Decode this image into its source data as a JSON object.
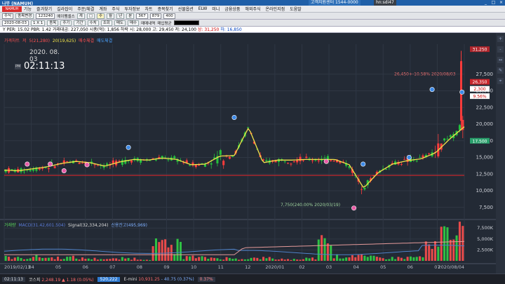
{
  "window": {
    "title": "나무 (NAMUH)",
    "customer_center": "고객지원센터 1544-0000",
    "account": "hn:sdi47",
    "buttons": [
      "_",
      "□",
      "×"
    ]
  },
  "menu": {
    "logo": "NAMUH",
    "items": [
      "기능",
      "즐겨찾기",
      "길라잡이",
      "주문/체결",
      "계좌",
      "주식",
      "투자정보",
      "차트",
      "종목찾기",
      "선물옵션",
      "ELW",
      "미니",
      "금융상품",
      "해외주식",
      "온라인지점",
      "도움말"
    ]
  },
  "toolbar1": {
    "chart_type": "주식",
    "search_label": "종목변경",
    "code": "123240",
    "name": "에이팸셀스",
    "tabs": [
      "계",
      "□",
      "주",
      "월",
      "년",
      "분"
    ],
    "period_value": "367",
    "count_value": "879",
    "view_value": "400"
  },
  "toolbar2": {
    "date": "2020-08-03",
    "x_label": "1 X 1",
    "buttons": [
      "종목",
      "주기",
      "기간",
      "수치",
      "조회"
    ],
    "right_buttons": [
      "매도",
      "매수"
    ],
    "trade_label": "매매내역",
    "avg_label": "매입평균",
    "color_box": ""
  },
  "info": {
    "text_left": "Y  PER: 15.02  PBR: 1.42  거래대금: 227,050  시총(억): 1,856  하락 시: 28,000  고: 29,450  저: 24,100",
    "high_label": "상: 31,250",
    "low_label": "하: 16,850"
  },
  "legend": {
    "items": [
      {
        "text": "가격차트",
        "color": "#ff5050"
      },
      {
        "text": "저",
        "color": "#ff5050"
      },
      {
        "text": "5(21,280)",
        "color": "#ff5050"
      },
      {
        "text": "20(19,625)",
        "color": "#f1e24a"
      },
      {
        "text": "매수체결",
        "color": "#ff5050"
      },
      {
        "text": "매도체결",
        "color": "#4aa3ff"
      }
    ]
  },
  "clock": {
    "date": "2020. 08. 03",
    "ampm": "PM",
    "time": "02:11:13"
  },
  "volume_legend": {
    "items": [
      {
        "text": "거래량",
        "color": "#5bd85b"
      },
      {
        "text": "MACD(31.42,601.504)",
        "color": "#5b7bd8"
      },
      {
        "text": "Signal(32,334,204)",
        "color": "#ddd"
      },
      {
        "text": "신용잔고(495,969)",
        "color": "#7fb0ff"
      }
    ]
  },
  "annotations": {
    "high": "26,450+-10.58% 2020/08/03",
    "low": "7,750(240.00% 2020/03/19)",
    "price_top": "31,250",
    "price_current": "26,350",
    "price_change": "2,300",
    "price_pct": "9.56%",
    "price_low_box": "17,500"
  },
  "colors": {
    "up": "#ff3b3b",
    "down": "#2e8ef0",
    "ma5": "#ff5050",
    "ma20": "#f1e24a",
    "reference": "#c0272d"
  },
  "chart_data": {
    "type": "candlestick",
    "price_axis": {
      "ticks": [
        7500,
        10000,
        12500,
        15000,
        17500,
        20000,
        22500,
        25000,
        27500
      ],
      "range": [
        6000,
        32000
      ]
    },
    "volume_axis": {
      "ticks": [
        "2,500K",
        "5,000K",
        "7,500K"
      ],
      "range": [
        0,
        8500
      ]
    },
    "reference_line": 12300,
    "x_labels": [
      "2019/02/13",
      "04",
      "05",
      "06",
      "07",
      "08",
      "09",
      "10",
      "11",
      "12",
      "2020/01",
      "02",
      "03",
      "04",
      "05",
      "06",
      "07",
      "2020/08/04"
    ],
    "ma20": [
      13.1,
      13.0,
      13.3,
      13.6,
      14.1,
      14.4,
      14.2,
      13.7,
      14.3,
      14.7,
      14.6,
      14.9,
      14.7,
      13.9,
      14.0,
      15.2,
      15.3,
      19.5,
      14.2,
      14.6,
      14.6,
      14.7,
      14.7,
      14.7,
      13.9,
      10.4,
      12.7,
      14.0,
      14.5,
      14.8,
      15.7,
      17.8,
      19.6
    ],
    "series": [
      {
        "name": "거래량",
        "values": [
          1.1,
          0.9,
          1.3,
          1.0,
          1.1,
          0.8,
          0.7,
          0.6,
          0.8,
          0.6,
          5.5,
          4.8,
          1.2,
          1.0,
          0.9,
          0.7,
          0.8,
          0.9,
          0.6,
          0.5,
          0.8,
          5.8,
          1.4,
          1.8,
          1.1,
          0.9,
          1.0,
          1.2,
          4.5,
          7.9,
          8.2
        ]
      }
    ]
  },
  "side_tools": [
    "+",
    "-",
    "↔",
    "✎",
    "⌖"
  ]
}
